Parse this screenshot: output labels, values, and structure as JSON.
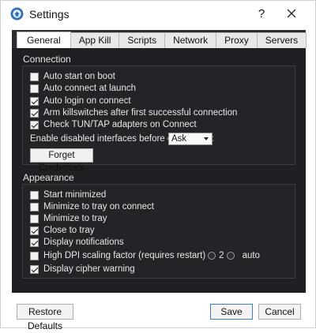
{
  "window": {
    "title": "Settings",
    "help_label": "?",
    "close_icon": "close-icon",
    "app_icon": "app-logo-icon"
  },
  "tabs": [
    {
      "label": "General",
      "active": true
    },
    {
      "label": "App Kill",
      "active": false
    },
    {
      "label": "Scripts",
      "active": false
    },
    {
      "label": "Network",
      "active": false
    },
    {
      "label": "Proxy",
      "active": false
    },
    {
      "label": "Servers",
      "active": false
    }
  ],
  "connection": {
    "title": "Connection",
    "options": [
      {
        "label": "Auto start on boot",
        "checked": false
      },
      {
        "label": "Auto connect at launch",
        "checked": false
      },
      {
        "label": "Auto login on connect",
        "checked": true
      },
      {
        "label": "Arm killswitches after first successful connection",
        "checked": true
      },
      {
        "label": "Check TUN/TAP adapters on Connect",
        "checked": true
      }
    ],
    "interfaces_label": "Enable disabled interfaces before connecting:",
    "interfaces_value": "Ask",
    "forget_button": "Forget Credentials"
  },
  "appearance": {
    "title": "Appearance",
    "options": [
      {
        "label": "Start minimized",
        "checked": false
      },
      {
        "label": "Minimize to tray on connect",
        "checked": false
      },
      {
        "label": "Minimize to tray",
        "checked": false
      },
      {
        "label": "Close to tray",
        "checked": true
      },
      {
        "label": "Display notifications",
        "checked": true
      },
      {
        "label": "High DPI scaling factor (requires restart)",
        "checked": false
      },
      {
        "label": "Display cipher warning",
        "checked": true
      }
    ],
    "dpi_option_2": "2",
    "dpi_option_auto": "auto"
  },
  "footer": {
    "restore_label": "Restore Defaults",
    "save_label": "Save",
    "cancel_label": "Cancel"
  },
  "colors": {
    "panel_bg": "#1f2023",
    "primary_border": "#3c7fc5"
  }
}
